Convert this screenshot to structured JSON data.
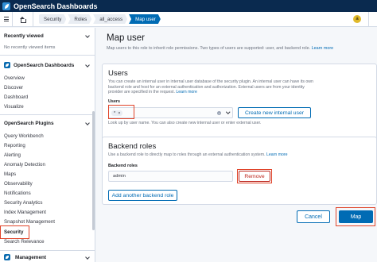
{
  "app": {
    "title": "OpenSearch Dashboards"
  },
  "breadcrumbs": [
    "Security",
    "Roles",
    "all_access",
    "Map user"
  ],
  "user": {
    "avatar_letter": "a"
  },
  "sidebar": {
    "recently_viewed": {
      "heading": "Recently viewed",
      "empty_text": "No recently viewed items"
    },
    "dashboards": {
      "heading": "OpenSearch Dashboards",
      "items": [
        "Overview",
        "Discover",
        "Dashboard",
        "Visualize"
      ]
    },
    "plugins": {
      "heading": "OpenSearch Plugins",
      "items": [
        "Query Workbench",
        "Reporting",
        "Alerting",
        "Anomaly Detection",
        "Maps",
        "Observability",
        "Notifications",
        "Security Analytics",
        "Index Management",
        "Snapshot Management",
        "Security",
        "Search Relevance"
      ],
      "selected": "Security"
    },
    "management": {
      "heading": "Management"
    }
  },
  "page": {
    "title": "Map user",
    "description": "Map users to this role to inherit role permissions. Two types of users are supported: user, and backend role.",
    "learn_more": "Learn more"
  },
  "users_panel": {
    "title": "Users",
    "description": "You can create an internal user in internal user database of the security plugin. An internal user can have its own backend role and host for an external authentication and authorization. External users are from your identity provider are specified in the request.",
    "learn_more": "Learn more",
    "field_label": "Users",
    "selected_values": [
      "*"
    ],
    "help_text": "Look up by user name. You can also create new internal user or enter external user.",
    "create_button": "Create new internal user"
  },
  "backend_panel": {
    "title": "Backend roles",
    "description": "Use a backend role to directly map to roles through an external authentication system.",
    "learn_more": "Learn more",
    "field_label": "Backend roles",
    "value": "admin",
    "remove_button": "Remove",
    "add_button": "Add another backend role"
  },
  "footer": {
    "cancel": "Cancel",
    "map": "Map"
  },
  "colors": {
    "header_bg": "#0a2a4f",
    "primary": "#006bb4",
    "danger": "#bd271e",
    "highlight": "#e0442a"
  }
}
